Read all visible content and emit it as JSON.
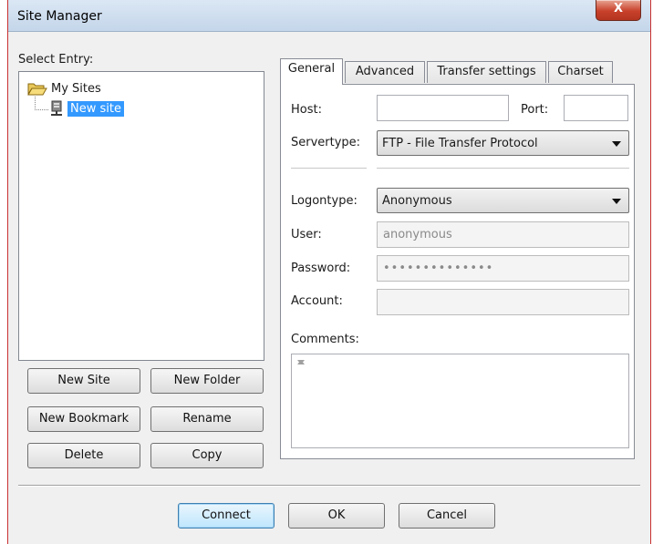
{
  "window": {
    "title": "Site Manager",
    "close_glyph": "X"
  },
  "left": {
    "select_entry_label": "Select Entry:",
    "tree": {
      "folder": {
        "label": "My Sites",
        "icon": "folder-open-icon"
      },
      "site": {
        "label": "New site",
        "icon": "server-icon",
        "selected": true
      }
    },
    "buttons": {
      "new_site": "New Site",
      "new_folder": "New Folder",
      "new_bookmark": "New Bookmark",
      "rename": "Rename",
      "delete": "Delete",
      "copy": "Copy"
    }
  },
  "tabs": [
    "General",
    "Advanced",
    "Transfer settings",
    "Charset"
  ],
  "active_tab": "General",
  "general": {
    "host_label": "Host:",
    "host_value": "",
    "port_label": "Port:",
    "port_value": "",
    "servertype_label": "Servertype:",
    "servertype_value": "FTP - File Transfer Protocol",
    "logontype_label": "Logontype:",
    "logontype_value": "Anonymous",
    "user_label": "User:",
    "user_value": "anonymous",
    "password_label": "Password:",
    "password_value": "••••••••••••••",
    "account_label": "Account:",
    "account_value": "",
    "comments_label": "Comments:",
    "comments_value": ""
  },
  "footer": {
    "connect": "Connect",
    "ok": "OK",
    "cancel": "Cancel"
  },
  "colors": {
    "selection": "#3399ff",
    "title_bar": "#c4d6ea",
    "close_button": "#c8412b",
    "window_border": "#c93030"
  }
}
